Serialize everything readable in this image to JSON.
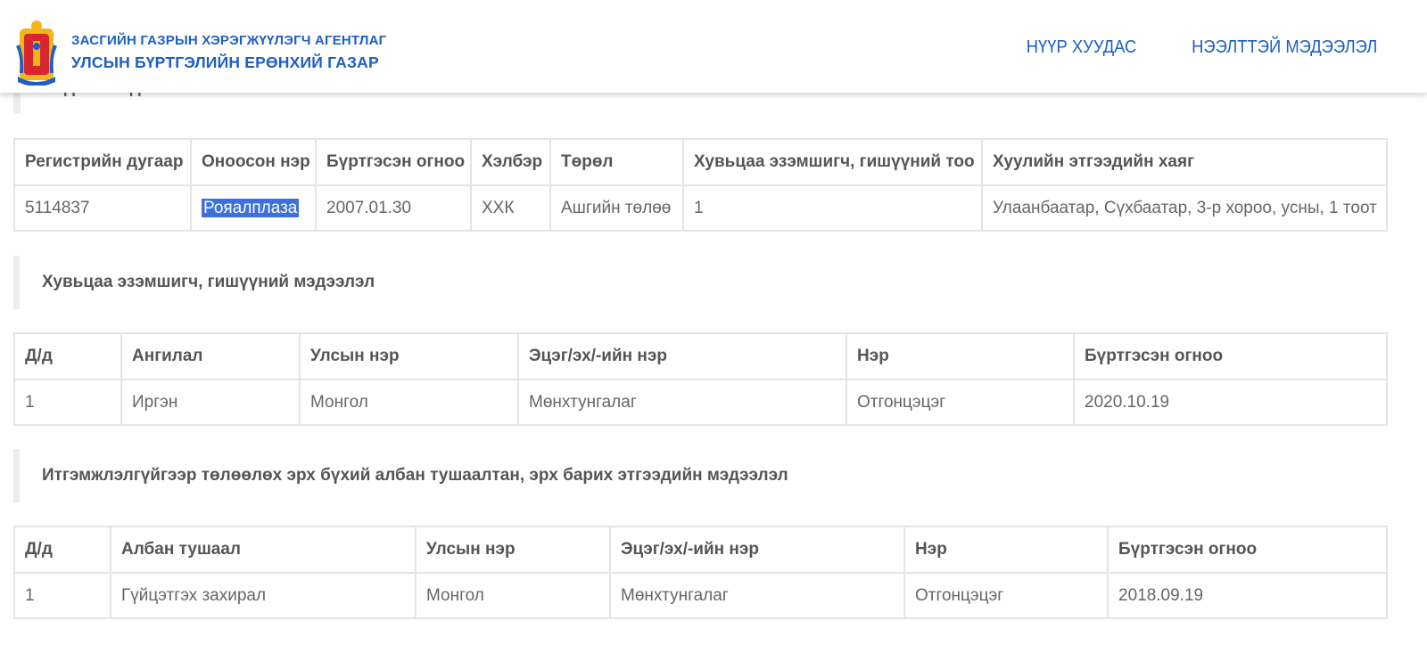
{
  "header": {
    "org_line1": "ЗАСГИЙН ГАЗРЫН ХЭРЭГЖҮҮЛЭГЧ АГЕНТЛАГ",
    "org_line2": "УЛСЫН БҮРТГЭЛИЙН ЕРӨНХИЙ ГАЗАР",
    "nav": [
      "НҮҮР ХУУДАС",
      "НЭЭЛТТЭЙ МЭДЭЭЛЭЛ"
    ],
    "logo_icon": "soyombo-emblem-icon",
    "brand_color": "#1e5fc4"
  },
  "peek_heading": "Үндсэн мэдээлэл",
  "company_table": {
    "headers": [
      "Регистрийн дугаар",
      "Оноосон нэр",
      "Бүртгэсэн огноо",
      "Хэлбэр",
      "Төрөл",
      "Хувьцаа эзэмшигч, гишүүний тоо",
      "Хуулийн этгээдийн хаяг"
    ],
    "row": [
      "5114837",
      "Рояалплаза",
      "2007.01.30",
      "ХХК",
      "Ашгийн төлөө",
      "1",
      "Улаанбаатар, Сүхбаатар, 3-р хороо, усны, 1 тоот"
    ]
  },
  "shareholders": {
    "heading": "Хувьцаа эзэмшигч, гишүүний мэдээлэл",
    "headers": [
      "Д/д",
      "Ангилал",
      "Улсын нэр",
      "Эцэг/эх/-ийн нэр",
      "Нэр",
      "Бүртгэсэн огноо"
    ],
    "row": [
      "1",
      "Иргэн",
      "Монгол",
      "Мөнхтунгалаг",
      "Отгонцэцэг",
      "2020.10.19"
    ]
  },
  "officials": {
    "heading": "Итгэмжлэлгүйгээр төлөөлөх эрх бүхий албан тушаалтан, эрх барих этгээдийн мэдээлэл",
    "headers": [
      "Д/д",
      "Албан тушаал",
      "Улсын нэр",
      "Эцэг/эх/-ийн нэр",
      "Нэр",
      "Бүртгэсэн огноо"
    ],
    "row": [
      "1",
      "Гүйцэтгэх захирал",
      "Монгол",
      "Мөнхтунгалаг",
      "Отгонцэцэг",
      "2018.09.19"
    ]
  },
  "selection_color": "#3c6fe0"
}
